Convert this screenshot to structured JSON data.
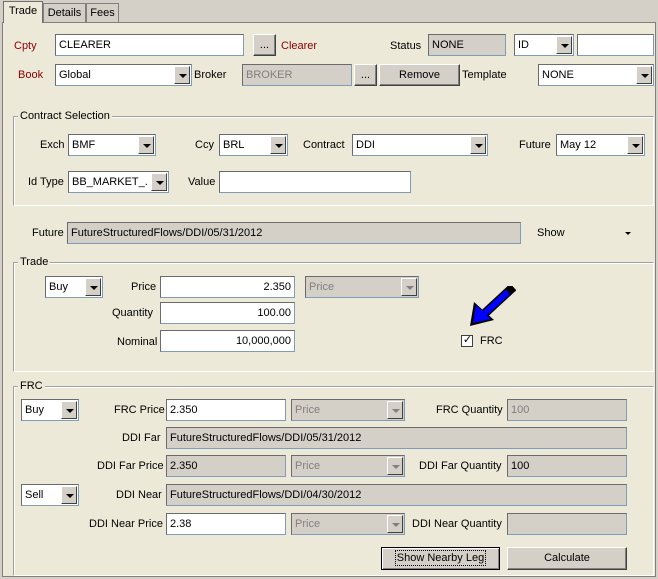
{
  "tabs": [
    {
      "label": "Trade",
      "active": true
    },
    {
      "label": "Details",
      "active": false
    },
    {
      "label": "Fees",
      "active": false
    }
  ],
  "header": {
    "cpty_label": "Cpty",
    "cpty_value": "CLEARER",
    "clearer_label": "Clearer",
    "status_label": "Status",
    "status_value": "NONE",
    "id_type_value": "ID",
    "id_value": "",
    "book_label": "Book",
    "book_value": "Global",
    "broker_label": "Broker",
    "broker_placeholder": "BROKER",
    "remove_label": "Remove",
    "template_label": "Template",
    "template_value": "NONE",
    "ellipsis": "..."
  },
  "contract_selection": {
    "title": "Contract Selection",
    "exch_label": "Exch",
    "exch_value": "BMF",
    "ccy_label": "Ccy",
    "ccy_value": "BRL",
    "contract_label": "Contract",
    "contract_value": "DDI",
    "future_label": "Future",
    "future_value": "May 12",
    "idtype_label": "Id Type",
    "idtype_value": "BB_MARKET_...",
    "value_label": "Value",
    "value_value": ""
  },
  "future_row": {
    "label": "Future",
    "value": "FutureStructuredFlows/DDI/05/31/2012",
    "show_label": "Show"
  },
  "trade": {
    "title": "Trade",
    "side_value": "Buy",
    "price_label": "Price",
    "price_value": "2.350",
    "price_type_value": "Price",
    "quantity_label": "Quantity",
    "quantity_value": "100.00",
    "nominal_label": "Nominal",
    "nominal_value": "10,000,000",
    "frc_checkbox_label": "FRC",
    "frc_checked": true,
    "check_mark": "✓"
  },
  "frc": {
    "title": "FRC",
    "side1_value": "Buy",
    "frc_price_label": "FRC Price",
    "frc_price_value": "2.350",
    "frc_price_type": "Price",
    "frc_quantity_label": "FRC Quantity",
    "frc_quantity_value": "100",
    "ddi_far_label": "DDI Far",
    "ddi_far_value": "FutureStructuredFlows/DDI/05/31/2012",
    "ddi_far_price_label": "DDI Far Price",
    "ddi_far_price_value": "2.350",
    "ddi_far_price_type": "Price",
    "ddi_far_quantity_label": "DDI Far Quantity",
    "ddi_far_quantity_value": "100",
    "side2_value": "Sell",
    "ddi_near_label": "DDI Near",
    "ddi_near_value": "FutureStructuredFlows/DDI/04/30/2012",
    "ddi_near_price_label": "DDI Near Price",
    "ddi_near_price_value": "2.38",
    "ddi_near_price_type": "Price",
    "ddi_near_quantity_label": "DDI Near Quantity",
    "ddi_near_quantity_value": "",
    "show_nearby_leg_label": "Show Nearby Leg",
    "calculate_label": "Calculate"
  },
  "colors": {
    "panel": "#ece9d8",
    "frame": "#d4d0c8",
    "required_label": "#8b0000",
    "annotation_arrow": "#0000ff"
  }
}
